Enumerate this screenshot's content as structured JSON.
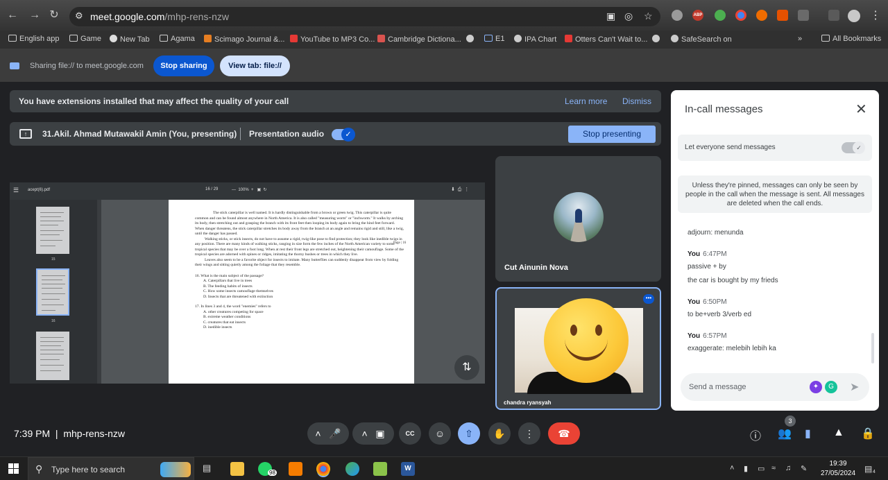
{
  "browser": {
    "url_host": "meet.google.com",
    "url_path": "/mhp-rens-nzw",
    "bookmarks": [
      "English app",
      "Game",
      "New Tab",
      "Agama",
      "Scimago Journal &...",
      "YouTube to MP3 Co...",
      "Cambridge Dictiona...",
      "E1",
      "IPA Chart",
      "Otters Can't Wait to...",
      "SafeSearch on",
      "All Bookmarks"
    ],
    "ext_badge": "ABP",
    "sharing_text": "Sharing file:// to meet.google.com",
    "stop_sharing": "Stop sharing",
    "view_tab": "View tab: file://"
  },
  "banner": {
    "message": "You have extensions installed that may affect the quality of your call",
    "learn_more": "Learn more",
    "dismiss": "Dismiss"
  },
  "presenting": {
    "who": "31.Akil. Ahmad Mutawakil Amin (You, presenting)",
    "audio_label": "Presentation audio",
    "audio_on": true,
    "stop_label": "Stop presenting"
  },
  "pdf": {
    "filename": "acept(6).pdf",
    "page_indicator": "16  /  29",
    "zoom": "100%",
    "thumb_labels": [
      "15",
      "16"
    ],
    "page_label": "Page | 16",
    "paragraphs": [
      "The stick caterpillar is well named. It is hardly distinguishable from a brown or green twig. This caterpillar is quite common and can be found almost anywhere in North America. It is also called \"measuring worm\" or \"inchworm.\" It walks by arching its body, then stretching out and grasping the branch with its front feet then looping its body again to bring the hind feet forward. When danger threatens, the stick caterpillar stretches its body away from the branch at an angle and remains rigid and still, like a twig, until the danger has passed.",
      "Walking sticks, or stick insects, do not have to assume a rigid, twig-like pose to find protection; they look like inedible twigs in any position. There are many kinds of walking sticks, ranging in size form the few inches of the North American variety to some tropical species that may be over a foot long. When at rest their front legs are stretched out, heightening their camouflage. Some of the tropical species are adorned with spines or ridges, imitating the thorny bushes or trees in which they live.",
      "Leaves also seem to be a favorite object for insects to imitate. Many butterflies can suddenly disappear from view by folding their wings and sitting quietly among the foliage that they resemble."
    ],
    "questions": [
      "16. What is the main subject of the passage?",
      "A. Caterpillars that live in trees",
      "B. The feeding habits of insects",
      "C. How some insects camouflage themselves",
      "D. Insects that are threatened with extinction",
      "17. In lines 3 and 4, the word \"enemies\" refers to",
      "A. other creatures competing for space",
      "B. extreme weather conditions",
      "C. creatures that eat insects",
      "D. inedible insects"
    ]
  },
  "tiles": {
    "participant1": "Cut Ainunin Nova",
    "participant2": "chandra ryansyah"
  },
  "chat": {
    "title": "In-call messages",
    "setting_label": "Let everyone send messages",
    "note": "Unless they're pinned, messages can only be seen by people in the call when the message is sent. All messages are deleted when the call ends.",
    "messages": [
      {
        "sender": "",
        "time": "",
        "text": "adjourn: menunda"
      },
      {
        "sender": "You",
        "time": "6:47PM",
        "text": "passive + by"
      },
      {
        "sender": "",
        "time": "",
        "text": "the car is bought by my frieds"
      },
      {
        "sender": "You",
        "time": "6:50PM",
        "text": "to be+verb 3/verb ed"
      },
      {
        "sender": "You",
        "time": "6:57PM",
        "text": "exaggerate: melebih lebih ka"
      }
    ],
    "input_placeholder": "Send a message"
  },
  "controls": {
    "time": "7:39 PM",
    "meeting_code": "mhp-rens-nzw",
    "people_count": "3"
  },
  "taskbar": {
    "search_placeholder": "Type here to search",
    "whatsapp_badge": "98",
    "clock_time": "19:39",
    "clock_date": "27/05/2024",
    "notif_count": "4"
  },
  "colors": {
    "accent": "#8ab4f8",
    "danger": "#ea4335",
    "primary": "#0b57d0"
  }
}
